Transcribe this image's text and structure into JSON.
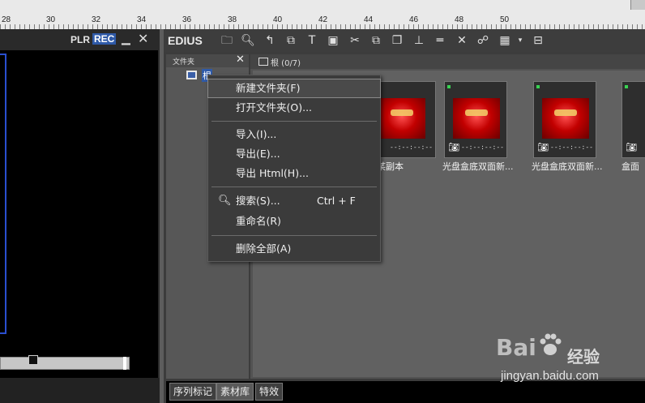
{
  "ruler": {
    "labels": [
      "28",
      "30",
      "32",
      "34",
      "36",
      "38",
      "40",
      "42",
      "44",
      "46",
      "48",
      "50"
    ]
  },
  "player": {
    "plr_label": "PLR",
    "rec_label": "REC",
    "minimize_glyph": "▁",
    "close_glyph": "✕"
  },
  "toolbar": {
    "app_name": "EDIUS",
    "icons": [
      "folder-icon",
      "search-icon",
      "up-arrow-icon",
      "add-folder-icon",
      "text-icon",
      "monitor-icon",
      "scissors-icon",
      "copy-icon",
      "paste-icon",
      "marker-icon",
      "line-icon",
      "delete-icon",
      "properties-icon",
      "view-mode-icon",
      "dropdown-icon",
      "folder-browse-icon"
    ]
  },
  "folder_panel": {
    "title": "文件夹",
    "close_glyph": "✕",
    "root_label": "根"
  },
  "bin": {
    "title": "根 (0/7)",
    "clips": [
      {
        "caption": "某副本",
        "timecode": "--:--:--:--"
      },
      {
        "caption": "光盘盒底双面新...",
        "timecode": "--:--:--:--"
      },
      {
        "caption": "光盘盒底双面新...",
        "timecode": "--:--:--:--"
      },
      {
        "caption": "盒面",
        "timecode": "--:--:--:--"
      }
    ]
  },
  "context_menu": {
    "items": [
      {
        "label": "新建文件夹(F)",
        "shortcut": ""
      },
      {
        "label": "打开文件夹(O)...",
        "shortcut": ""
      },
      {
        "label": "导入(I)...",
        "shortcut": ""
      },
      {
        "label": "导出(E)...",
        "shortcut": ""
      },
      {
        "label": "导出 Html(H)...",
        "shortcut": ""
      },
      {
        "label": "搜索(S)...",
        "shortcut": "Ctrl + F"
      },
      {
        "label": "重命名(R)",
        "shortcut": ""
      },
      {
        "label": "删除全部(A)",
        "shortcut": ""
      }
    ]
  },
  "tabs": [
    {
      "label": "序列标记",
      "active": false
    },
    {
      "label": "素材库",
      "active": true
    },
    {
      "label": "特效",
      "active": false
    }
  ],
  "watermark": {
    "logo": "Bai",
    "logo_cn": "经验",
    "url": "jingyan.baidu.com"
  },
  "colors": {
    "rec_bg": "#2f5aa8",
    "viewer_rim": "#2a4fd0",
    "status_dot": "#39d353"
  }
}
